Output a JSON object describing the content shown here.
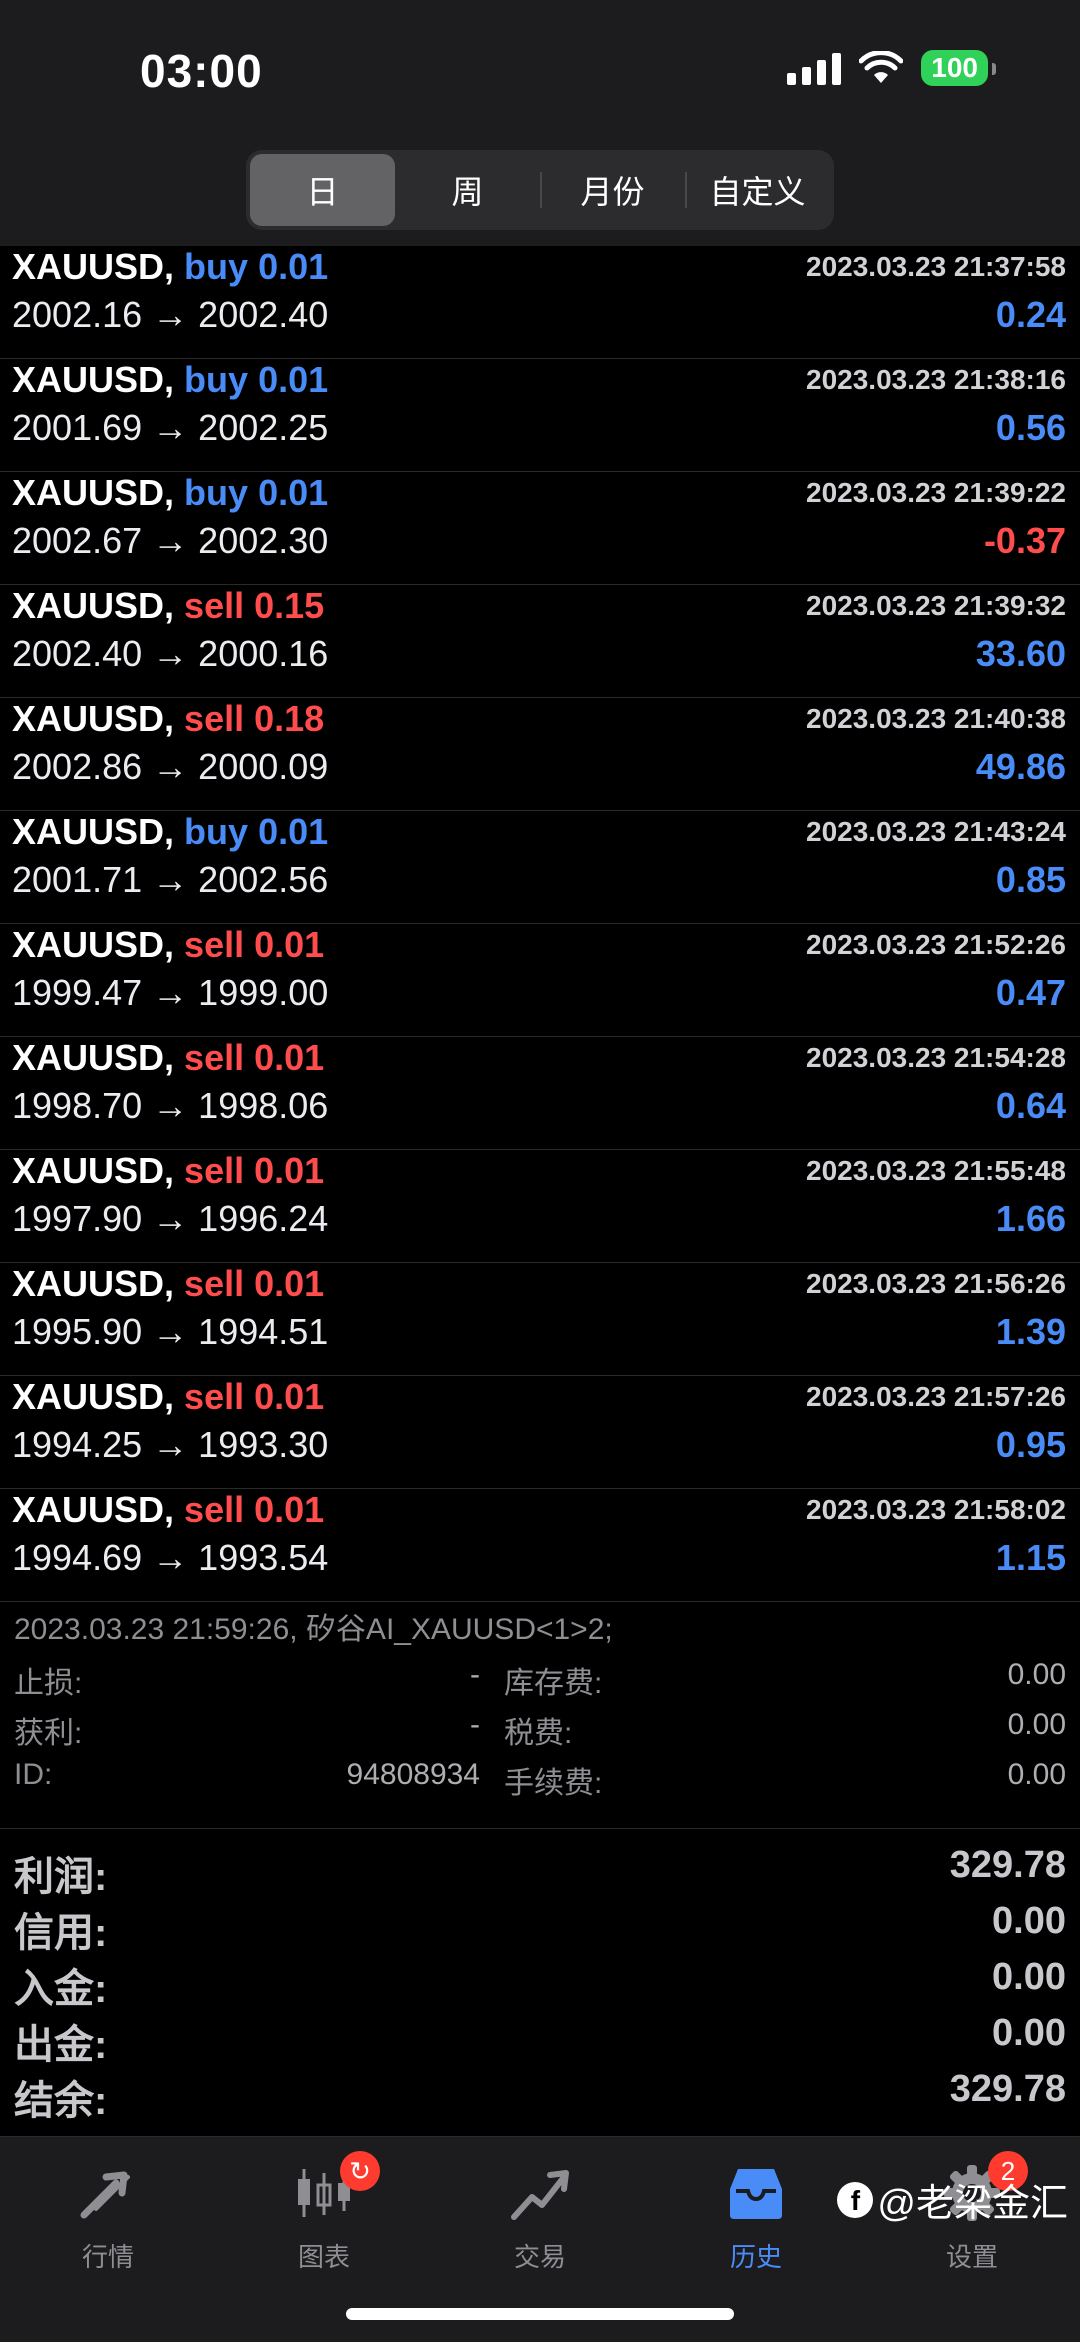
{
  "status_bar": {
    "time": "03:00",
    "battery": "100"
  },
  "segments": [
    {
      "label": "日",
      "active": true
    },
    {
      "label": "周",
      "active": false
    },
    {
      "label": "月份",
      "active": false
    },
    {
      "label": "自定义",
      "active": false
    }
  ],
  "trades": [
    {
      "symbol": "XAUUSD,",
      "side": "buy",
      "volume": "0.01",
      "time": "2023.03.23 21:37:58",
      "open": "2002.16",
      "close": "2002.40",
      "profit": "0.24"
    },
    {
      "symbol": "XAUUSD,",
      "side": "buy",
      "volume": "0.01",
      "time": "2023.03.23 21:38:16",
      "open": "2001.69",
      "close": "2002.25",
      "profit": "0.56"
    },
    {
      "symbol": "XAUUSD,",
      "side": "buy",
      "volume": "0.01",
      "time": "2023.03.23 21:39:22",
      "open": "2002.67",
      "close": "2002.30",
      "profit": "-0.37"
    },
    {
      "symbol": "XAUUSD,",
      "side": "sell",
      "volume": "0.15",
      "time": "2023.03.23 21:39:32",
      "open": "2002.40",
      "close": "2000.16",
      "profit": "33.60"
    },
    {
      "symbol": "XAUUSD,",
      "side": "sell",
      "volume": "0.18",
      "time": "2023.03.23 21:40:38",
      "open": "2002.86",
      "close": "2000.09",
      "profit": "49.86"
    },
    {
      "symbol": "XAUUSD,",
      "side": "buy",
      "volume": "0.01",
      "time": "2023.03.23 21:43:24",
      "open": "2001.71",
      "close": "2002.56",
      "profit": "0.85"
    },
    {
      "symbol": "XAUUSD,",
      "side": "sell",
      "volume": "0.01",
      "time": "2023.03.23 21:52:26",
      "open": "1999.47",
      "close": "1999.00",
      "profit": "0.47"
    },
    {
      "symbol": "XAUUSD,",
      "side": "sell",
      "volume": "0.01",
      "time": "2023.03.23 21:54:28",
      "open": "1998.70",
      "close": "1998.06",
      "profit": "0.64"
    },
    {
      "symbol": "XAUUSD,",
      "side": "sell",
      "volume": "0.01",
      "time": "2023.03.23 21:55:48",
      "open": "1997.90",
      "close": "1996.24",
      "profit": "1.66"
    },
    {
      "symbol": "XAUUSD,",
      "side": "sell",
      "volume": "0.01",
      "time": "2023.03.23 21:56:26",
      "open": "1995.90",
      "close": "1994.51",
      "profit": "1.39"
    },
    {
      "symbol": "XAUUSD,",
      "side": "sell",
      "volume": "0.01",
      "time": "2023.03.23 21:57:26",
      "open": "1994.25",
      "close": "1993.30",
      "profit": "0.95"
    },
    {
      "symbol": "XAUUSD,",
      "side": "sell",
      "volume": "0.01",
      "time": "2023.03.23 21:58:02",
      "open": "1994.69",
      "close": "1993.54",
      "profit": "1.15"
    }
  ],
  "detail": {
    "meta": "2023.03.23 21:59:26, 矽谷AI_XAUUSD<1>2;",
    "stop_loss_label": "止损:",
    "stop_loss": "-",
    "take_profit_label": "获利:",
    "take_profit": "-",
    "id_label": "ID:",
    "id": "94808934",
    "swap_label": "库存费:",
    "swap": "0.00",
    "tax_label": "税费:",
    "tax": "0.00",
    "commission_label": "手续费:",
    "commission": "0.00"
  },
  "summary": [
    {
      "label": "利润:",
      "value": "329.78"
    },
    {
      "label": "信用:",
      "value": "0.00"
    },
    {
      "label": "入金:",
      "value": "0.00"
    },
    {
      "label": "出金:",
      "value": "0.00"
    },
    {
      "label": "结余:",
      "value": "329.78"
    }
  ],
  "tabs": [
    {
      "label": "行情",
      "icon": "quotes-arrows-icon",
      "active": false
    },
    {
      "label": "图表",
      "icon": "candlestick-chart-icon",
      "active": false,
      "badge": "↻"
    },
    {
      "label": "交易",
      "icon": "trade-trend-icon",
      "active": false
    },
    {
      "label": "历史",
      "icon": "history-inbox-icon",
      "active": true
    },
    {
      "label": "设置",
      "icon": "gear-icon",
      "active": false,
      "badge": "2"
    }
  ],
  "watermark": "@老梁金汇",
  "colors": {
    "buy": "#4a8cf7",
    "sell": "#ff4d4d",
    "active_tab": "#4a8cf7",
    "battery": "#30d158"
  }
}
